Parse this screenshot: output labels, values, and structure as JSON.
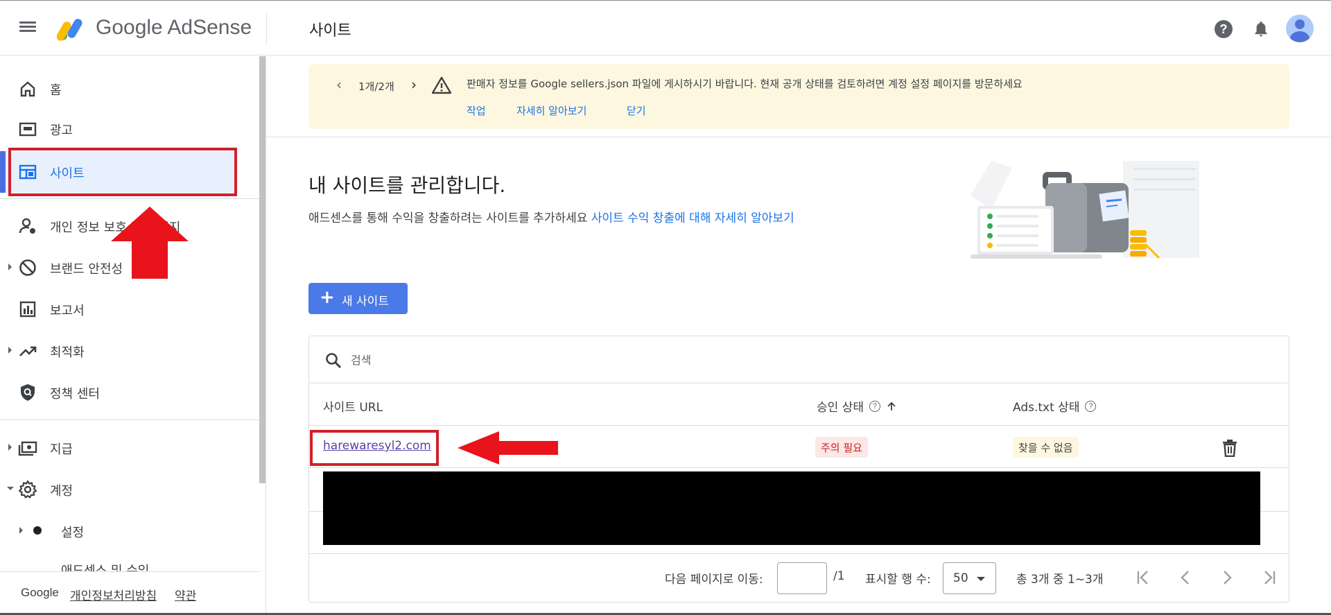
{
  "header": {
    "brand": "Google AdSense",
    "page_title": "사이트"
  },
  "sidebar": {
    "items": [
      {
        "label": "홈"
      },
      {
        "label": "광고"
      },
      {
        "label": "사이트"
      },
      {
        "label": "개인 정보 보호 및 메시지"
      },
      {
        "label": "브랜드 안전성"
      },
      {
        "label": "보고서"
      },
      {
        "label": "최적화"
      },
      {
        "label": "정책 센터"
      },
      {
        "label": "지급"
      },
      {
        "label": "계정"
      },
      {
        "label": "설정"
      },
      {
        "label": "애드센스 및 수익"
      }
    ],
    "footer": {
      "google": "Google",
      "privacy": "개인정보처리방침",
      "terms": "약관"
    }
  },
  "notice": {
    "counter": "1개/2개",
    "message": "판매자 정보를 Google sellers.json 파일에 게시하시기 바랍니다. 현재 공개 상태를 검토하려면 계정 설정 페이지를 방문하세요",
    "actions": [
      "작업",
      "자세히 알아보기",
      "닫기"
    ]
  },
  "main": {
    "heading": "내 사이트를 관리합니다.",
    "subtext": "애드센스를 통해 수익을 창출하려는 사이트를 추가하세요",
    "sublink": "사이트 수익 창출에 대해 자세히 알아보기",
    "new_site_label": "새 사이트"
  },
  "table": {
    "search_placeholder": "검색",
    "columns": [
      "사이트 URL",
      "승인 상태",
      "Ads.txt 상태"
    ],
    "rows": [
      {
        "url": "harewaresyl2.com",
        "approval": "주의 필요",
        "ads_txt": "찾을 수 없음"
      }
    ],
    "footer": {
      "goto_label": "다음 페이지로 이동:",
      "page_total": "/1",
      "rows_label": "표시할 행 수:",
      "rows_value": "50",
      "summary": "총 3개 중 1~3개"
    }
  },
  "colors": {
    "accent": "#1a73e8",
    "button": "#4a79e8",
    "annotation": "#d0202a",
    "notice_bg": "#fef7e0"
  }
}
